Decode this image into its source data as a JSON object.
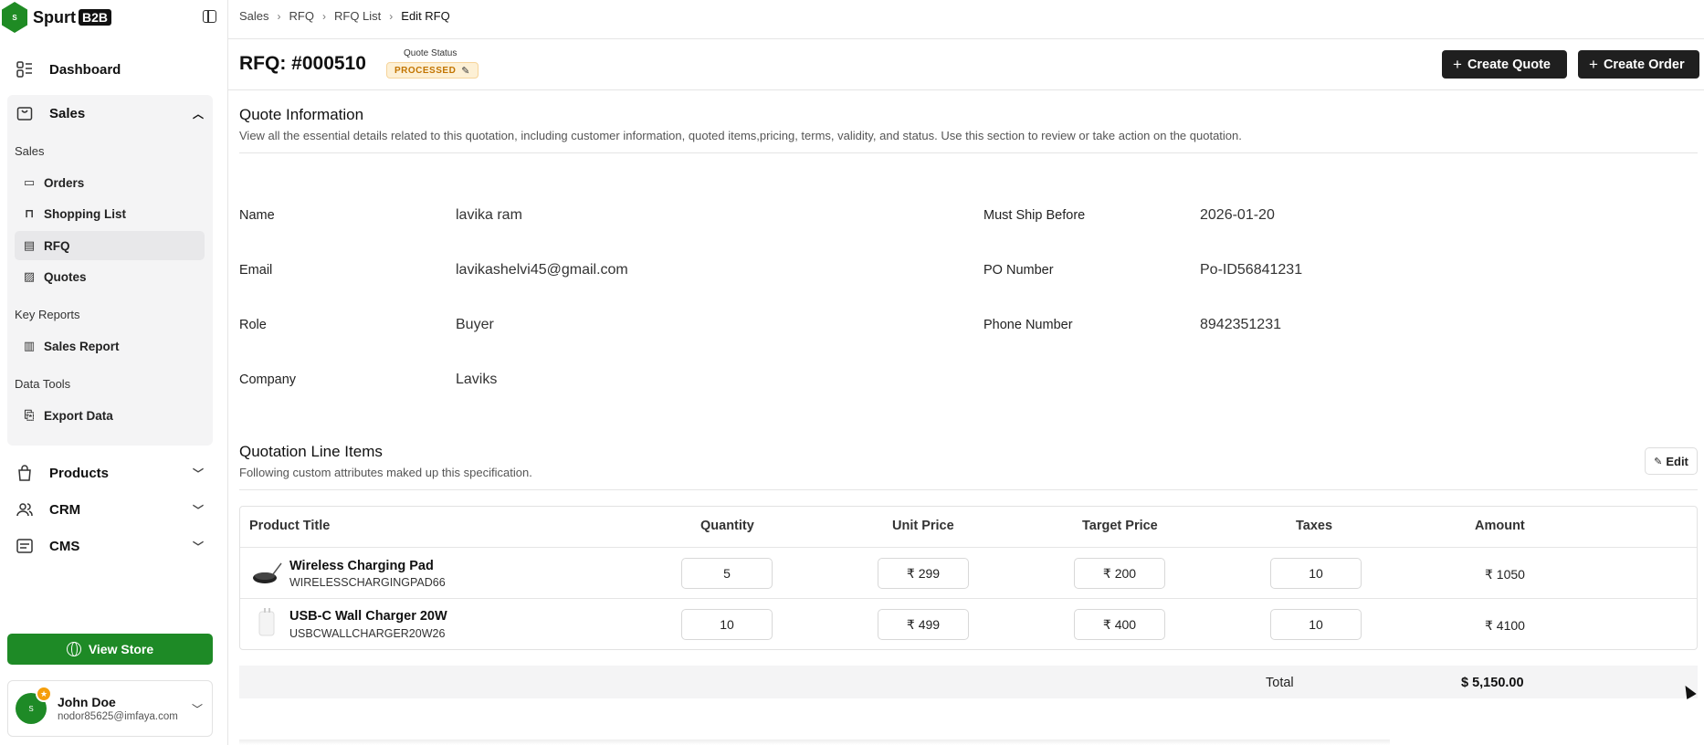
{
  "brand": {
    "name": "Spurt",
    "suffix": "B2B"
  },
  "sidebar": {
    "dashboard": "Dashboard",
    "sales": "Sales",
    "sales_section": "Sales",
    "sales_items": [
      "Orders",
      "Shopping List",
      "RFQ",
      "Quotes"
    ],
    "key_reports_section": "Key Reports",
    "key_reports_items": [
      "Sales Report"
    ],
    "data_tools_section": "Data Tools",
    "data_tools_items": [
      "Export Data"
    ],
    "products": "Products",
    "crm": "CRM",
    "cms": "CMS",
    "view_store": "View Store",
    "user": {
      "name": "John Doe",
      "email": "nodor85625@imfaya.com"
    }
  },
  "breadcrumb": [
    "Sales",
    "RFQ",
    "RFQ List",
    "Edit RFQ"
  ],
  "header": {
    "title": "RFQ: #000510",
    "status_label": "Quote Status",
    "status": "PROCESSED",
    "create_quote": "Create Quote",
    "create_order": "Create Order"
  },
  "quote_info": {
    "title": "Quote Information",
    "description": "View all the essential details related to this quotation, including customer information, quoted items,pricing, terms, validity, and status. Use this section to review or take action on the quotation.",
    "fields": {
      "name_label": "Name",
      "name": "lavika ram",
      "email_label": "Email",
      "email": "lavikashelvi45@gmail.com",
      "role_label": "Role",
      "role": "Buyer",
      "company_label": "Company",
      "company": "Laviks",
      "ship_label": "Must Ship Before",
      "ship": "2026-01-20",
      "po_label": "PO Number",
      "po": "Po-ID56841231",
      "phone_label": "Phone Number",
      "phone": "8942351231"
    }
  },
  "line_items": {
    "title": "Quotation Line Items",
    "description": "Following custom attributes maked up this specification.",
    "edit": "Edit",
    "columns": [
      "Product Title",
      "Quantity",
      "Unit Price",
      "Target Price",
      "Taxes",
      "Amount"
    ],
    "rows": [
      {
        "name": "Wireless Charging Pad",
        "sku": "WIRELESSCHARGINGPAD66",
        "quantity": "5",
        "unit_price": "₹ 299",
        "target_price": "₹ 200",
        "taxes": "10",
        "amount": "₹ 1050"
      },
      {
        "name": "USB-C Wall Charger 20W",
        "sku": "USBCWALLCHARGER20W26",
        "quantity": "10",
        "unit_price": "₹ 499",
        "target_price": "₹ 400",
        "taxes": "10",
        "amount": "₹ 4100"
      }
    ],
    "total_label": "Total",
    "total_value": "$ 5,150.00"
  },
  "colors": {
    "brand_green": "#1e8a26",
    "status_orange": "#c27400",
    "dark_button": "#1f1f1f"
  }
}
